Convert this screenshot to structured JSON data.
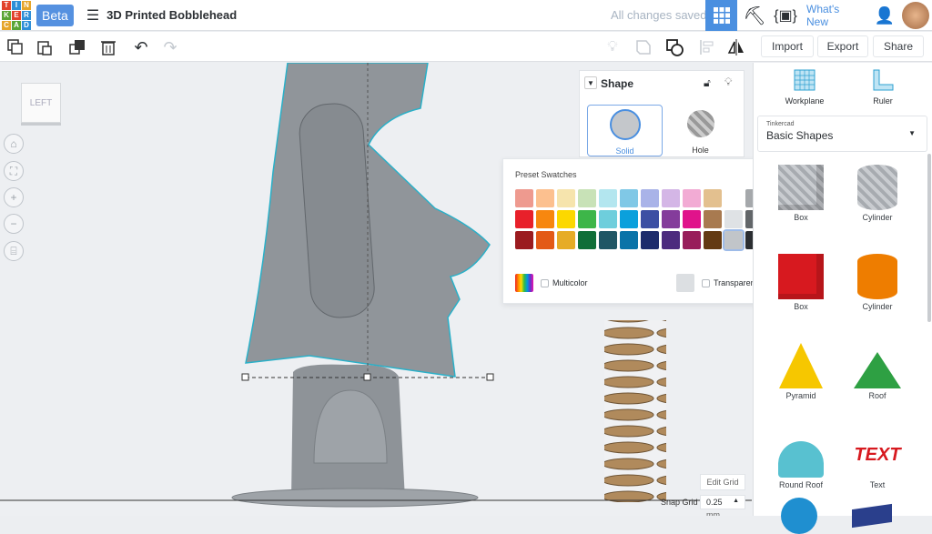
{
  "header": {
    "logo_letters": [
      "T",
      "I",
      "N",
      "K",
      "E",
      "R",
      "C",
      "A",
      "D"
    ],
    "beta": "Beta",
    "project_title": "3D Printed Bobblehead",
    "status": "All changes saved",
    "whats_new": "What's New"
  },
  "toolbar": {
    "import": "Import",
    "export": "Export",
    "share": "Share"
  },
  "viewcube": {
    "face": "LEFT"
  },
  "inspector": {
    "title": "Shape",
    "solid": "Solid",
    "hole": "Hole"
  },
  "swatches": {
    "title": "Preset Swatches",
    "multicolor": "Multicolor",
    "transparent": "Transparent",
    "rows": [
      [
        "#ee9a8f",
        "#fcc08f",
        "#f6e4ad",
        "#c8e2b7",
        "#b3e6ef",
        "#80c8e6",
        "#a9b3e8",
        "#d4b6e6",
        "#f2abd4",
        "#e3c08f",
        "",
        "#a5a8ab"
      ],
      [
        "#e8202a",
        "#f7870f",
        "#fcd800",
        "#3db649",
        "#6ecedc",
        "#0ba0dc",
        "#3c4fa3",
        "#843c9b",
        "#e0138b",
        "#a87a50",
        "#dfe2e5",
        "#626669"
      ],
      [
        "#9b1b1f",
        "#e35a16",
        "#e6ac26",
        "#0f6e38",
        "#1f5665",
        "#0a73a8",
        "#1d2c6c",
        "#4c2b7e",
        "#981e5b",
        "#633a13",
        "#c1c5c9",
        "#2b2e31"
      ]
    ],
    "selected": "#c1c5c9"
  },
  "panel": {
    "workplane": "Workplane",
    "ruler": "Ruler",
    "library_source": "Tinkercad",
    "library": "Basic Shapes",
    "shapes": [
      {
        "label": "Box",
        "color": "#b9bcc1"
      },
      {
        "label": "Cylinder",
        "color": "#b9bcc1"
      },
      {
        "label": "Box",
        "color": "#d7191f"
      },
      {
        "label": "Cylinder",
        "color": "#ee7d00"
      },
      {
        "label": "Pyramid",
        "color": "#f6c700"
      },
      {
        "label": "Roof",
        "color": "#2ea043"
      },
      {
        "label": "Round Roof",
        "color": "#58c1d0"
      },
      {
        "label": "Text",
        "color": "#d7191f"
      }
    ]
  },
  "grid": {
    "edit": "Edit Grid",
    "snap_label": "Snap Grid",
    "snap_value": "0.25",
    "snap_unit": "mm"
  },
  "colors": {
    "accent": "#5591e0",
    "brand_blue": "#3f8ee4"
  }
}
